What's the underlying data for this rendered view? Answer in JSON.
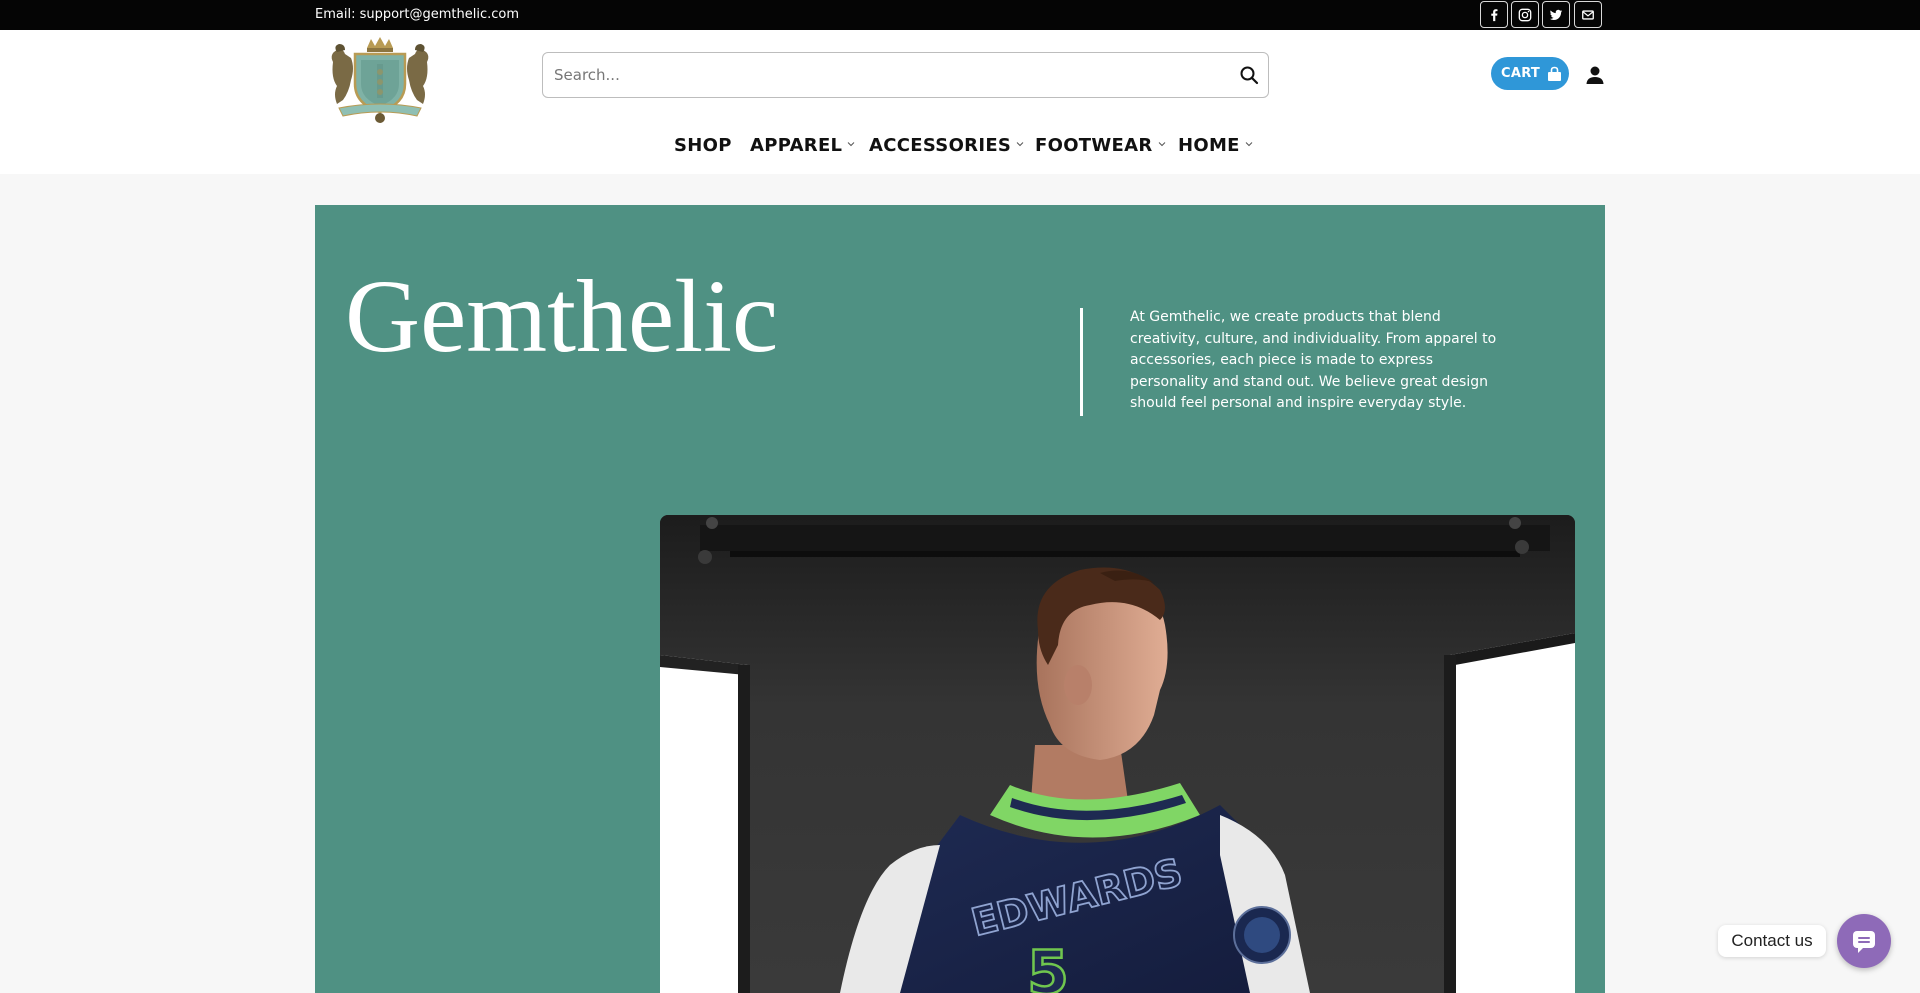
{
  "topbar": {
    "email": "Email: support@gemthelic.com",
    "social": [
      {
        "icon": "facebook-icon"
      },
      {
        "icon": "instagram-icon"
      },
      {
        "icon": "twitter-icon"
      },
      {
        "icon": "mail-icon"
      }
    ]
  },
  "header": {
    "logo_icon": "crest-logo",
    "search": {
      "placeholder": "Search..."
    },
    "cart_label": "CART",
    "cart_color": "#2f97d8"
  },
  "nav": {
    "items": [
      {
        "label": "SHOP",
        "dropdown": false
      },
      {
        "label": "APPAREL",
        "dropdown": true
      },
      {
        "label": "ACCESSORIES",
        "dropdown": true
      },
      {
        "label": "FOOTWEAR",
        "dropdown": true
      },
      {
        "label": "HOME",
        "dropdown": true
      }
    ]
  },
  "hero": {
    "title": "Gemthelic",
    "description": "At Gemthelic, we create products that blend creativity, culture, and individuality. From apparel to accessories, each piece is made to express personality and stand out. We believe great design should feel personal and inspire everyday style.",
    "background_color": "#4f9183"
  },
  "photo": {
    "jacket_text": "EDWARDS",
    "jacket_number": "5"
  },
  "contact": {
    "label": "Contact us",
    "color": "#8e6ab8"
  }
}
